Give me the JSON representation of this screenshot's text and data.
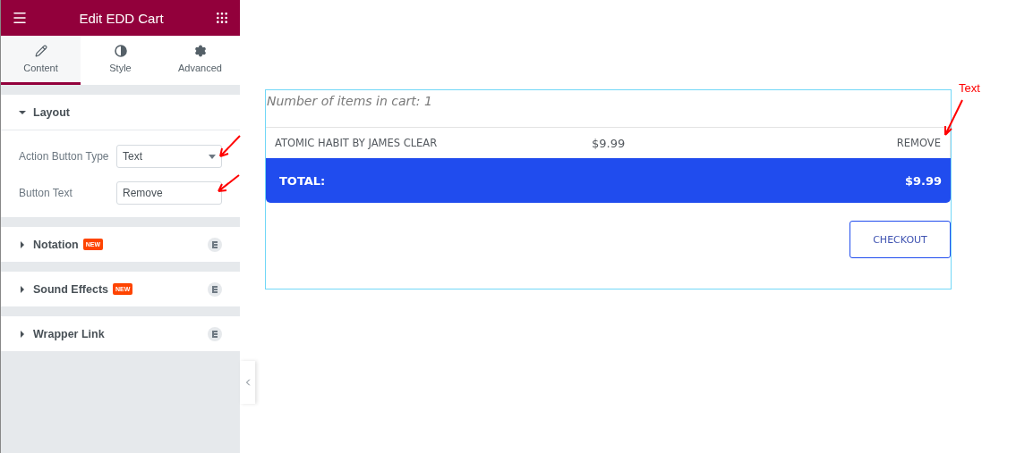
{
  "panel": {
    "title": "Edit EDD Cart",
    "tabs": [
      {
        "label": "Content",
        "selected": true
      },
      {
        "label": "Style",
        "selected": false
      },
      {
        "label": "Advanced",
        "selected": false
      }
    ],
    "sections": [
      {
        "title": "Layout",
        "expanded": true,
        "controls": [
          {
            "kind": "select",
            "label": "Action Button Type",
            "value": "Text"
          },
          {
            "kind": "text",
            "label": "Button Text",
            "value": "Remove"
          }
        ]
      },
      {
        "title": "Notation",
        "badge": "NEW",
        "expanded": false
      },
      {
        "title": "Sound Effects",
        "badge": "NEW",
        "expanded": false
      },
      {
        "title": "Wrapper Link",
        "expanded": false
      }
    ]
  },
  "cart": {
    "count_text": "Number of items in cart: 1",
    "items": [
      {
        "name": "ATOMIC HABIT BY JAMES CLEAR",
        "price": "$9.99",
        "action": "REMOVE"
      }
    ],
    "total_label": "TOTAL:",
    "total": "$9.99",
    "checkout": "CHECKOUT"
  },
  "annotation": "Text"
}
